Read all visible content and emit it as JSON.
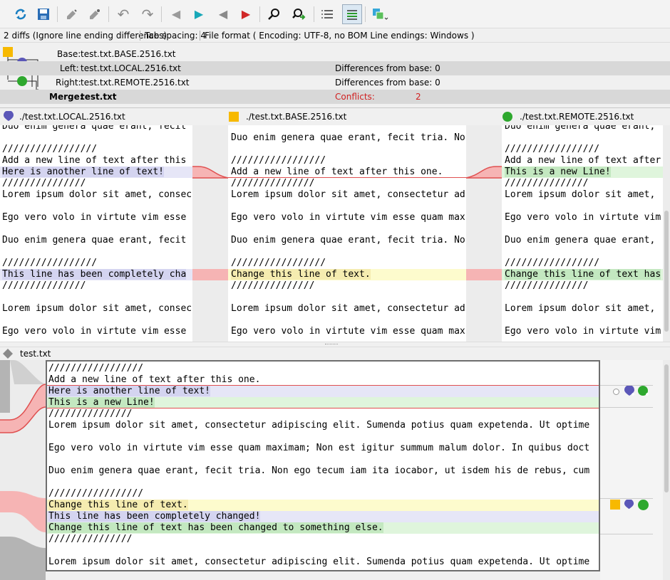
{
  "toolbar": {
    "icons": [
      "refresh-icon",
      "save-icon",
      "previous-conflict-icon",
      "next-conflict-icon",
      "undo-icon",
      "redo-icon",
      "previous-change-left-icon",
      "next-change-icon",
      "previous-conflict-red-icon",
      "next-conflict-red-icon",
      "find-icon",
      "find-next-icon",
      "line-numbers-icon",
      "whitespace-icon",
      "compare-mode-icon"
    ]
  },
  "status": {
    "diffs": "2 diffs (Ignore line ending differences)",
    "tab": "Tab spacing: 4",
    "format": "File format ( Encoding: UTF-8, no BOM  Line endings: Windows )"
  },
  "files": {
    "base_label": "Base:",
    "base_name": "test.txt.BASE.2516.txt",
    "left_label": "Left:",
    "left_name": "test.txt.LOCAL.2516.txt",
    "left_diff": "Differences from base: 0",
    "right_label": "Right:",
    "right_name": "test.txt.REMOTE.2516.txt",
    "right_diff": "Differences from base: 0",
    "merge_label": "Merge:",
    "merge_name": "test.txt",
    "conflicts_label": "Conflicts:",
    "conflicts_value": "2"
  },
  "headers": {
    "left": "./test.txt.LOCAL.2516.txt",
    "base": "./test.txt.BASE.2516.txt",
    "right": "./test.txt.REMOTE.2516.txt"
  },
  "left_pane": {
    "lines": [
      "Duo enim genera quae erant, fecit",
      "",
      "/////////////////",
      "Add a new line of text after this",
      "Here is another line of text!",
      "///////////////",
      "Lorem ipsum dolor sit amet, consec",
      "",
      "Ego vero volo in virtute vim esse",
      "",
      "Duo enim genera quae erant, fecit",
      "",
      "/////////////////",
      "This line has been completely cha",
      "///////////////",
      "",
      "Lorem ipsum dolor sit amet, consec",
      "",
      "Ego vero volo in virtute vim esse"
    ]
  },
  "base_pane": {
    "lines": [
      "",
      "Duo enim genera quae erant, fecit tria. No",
      "",
      "/////////////////",
      "Add a new line of text after this one.",
      "///////////////",
      "Lorem ipsum dolor sit amet, consectetur ad",
      "",
      "Ego vero volo in virtute vim esse quam max",
      "",
      "Duo enim genera quae erant, fecit tria. No",
      "",
      "/////////////////",
      "Change this line of text.",
      "///////////////",
      "",
      "Lorem ipsum dolor sit amet, consectetur ad",
      "",
      "Ego vero volo in virtute vim esse quam max"
    ]
  },
  "right_pane": {
    "lines": [
      "Duo enim genera quae erant,",
      "",
      "/////////////////",
      "Add a new line of text after",
      "This is a new Line!",
      "///////////////",
      "Lorem ipsum dolor sit amet,",
      "",
      "Ego vero volo in virtute vim",
      "",
      "Duo enim genera quae erant,",
      "",
      "/////////////////",
      "Change this line of text has",
      "///////////////",
      "",
      "Lorem ipsum dolor sit amet,",
      "",
      "Ego vero volo in virtute vim"
    ]
  },
  "merge_header": {
    "label": "test.txt"
  },
  "merge_pane": {
    "lines": [
      "/////////////////",
      "Add a new line of text after this one.",
      "Here is another line of text!",
      "This is a new Line!",
      "///////////////",
      "Lorem ipsum dolor sit amet, consectetur adipiscing elit. Sumenda potius quam expetenda. Ut optime",
      "",
      "Ego vero volo in virtute vim esse quam maximam; Non est igitur summum malum dolor. In quibus doct",
      "",
      "Duo enim genera quae erant, fecit tria. Non ego tecum iam ita iocabor, ut isdem his de rebus, cum",
      "",
      "/////////////////",
      "Change this line of text.",
      "This line has been completely changed!",
      "Change this line of text has been changed to something else.",
      "///////////////",
      "",
      "Lorem ipsum dolor sit amet, consectetur adipiscing elit. Sumenda potius quam expetenda. Ut optime"
    ]
  },
  "colors": {
    "left": "#5b57b8",
    "base": "#f7b900",
    "right": "#2ea82e",
    "conflict": "#e05050",
    "conflict_fill": "#f6b4b4"
  }
}
